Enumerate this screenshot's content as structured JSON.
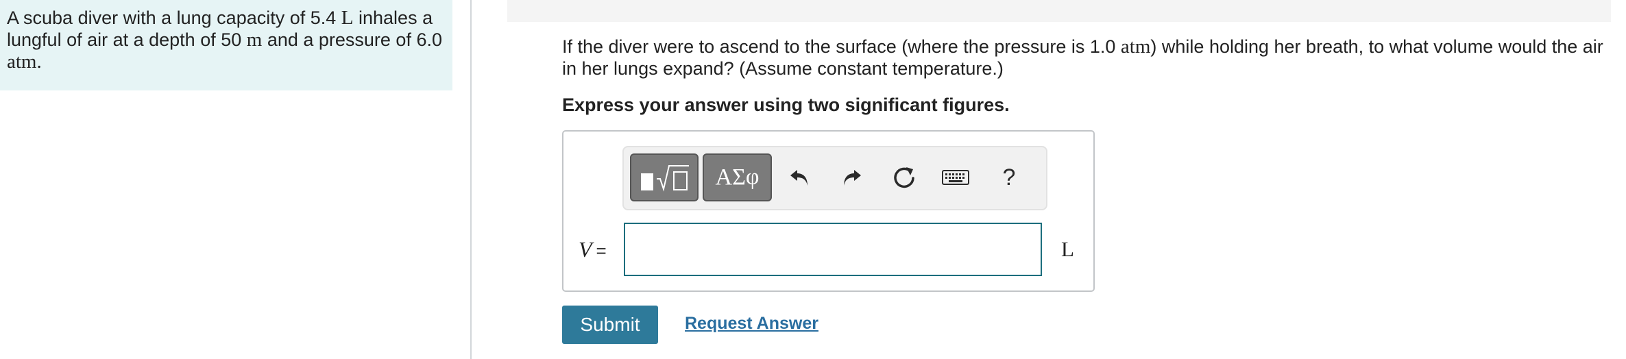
{
  "problem": {
    "text_1": "A scuba diver with a lung capacity of 5.4 ",
    "unit_L": "L",
    "text_2": " inhales a lungful of air at a depth of 50 ",
    "unit_m": "m",
    "text_3": " and a pressure of 6.0 ",
    "unit_atm": "atm",
    "text_4": "."
  },
  "question": {
    "text_1": "If the diver were to ascend to the surface (where the pressure is 1.0 ",
    "unit_atm": "atm",
    "text_2": ") while holding her breath, to what volume would the air in her lungs expand? (Assume constant temperature.)"
  },
  "instruction": "Express your answer using two significant figures.",
  "toolbar": {
    "symbols_label": "ΑΣφ",
    "help_label": "?",
    "icons": [
      "templates-icon",
      "undo-icon",
      "redo-icon",
      "reset-icon",
      "keyboard-icon",
      "help-icon"
    ]
  },
  "answer": {
    "variable": "V",
    "equals": "=",
    "value": "",
    "unit": "L"
  },
  "actions": {
    "submit_label": "Submit",
    "request_label": "Request Answer"
  },
  "colors": {
    "problem_bg": "#e6f4f5",
    "submit_bg": "#2e7a9a",
    "link": "#2a6ea0",
    "input_border": "#1c6e7d",
    "toolbar_button": "#7b7b7b"
  }
}
